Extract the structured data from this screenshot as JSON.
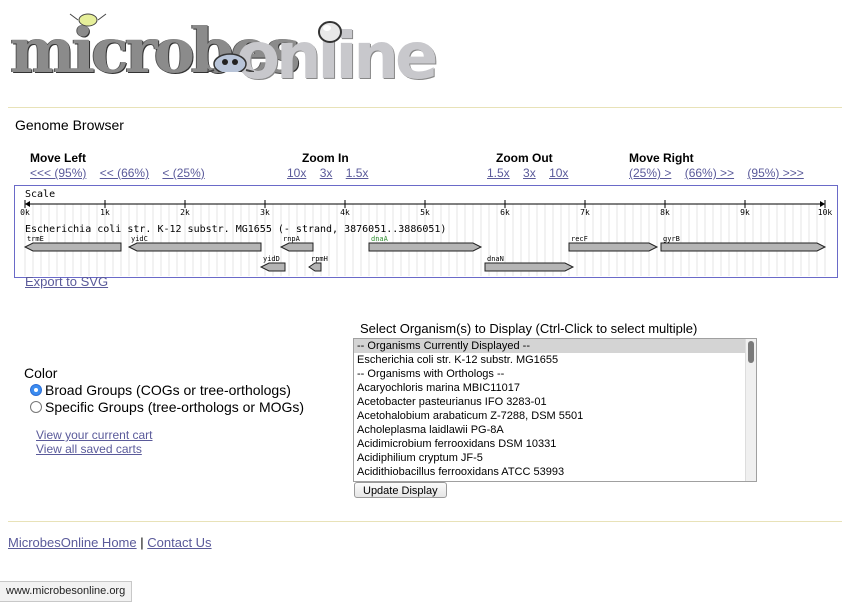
{
  "logo": {
    "left": "microbes",
    "right": "online"
  },
  "browser_title": "Genome Browser",
  "nav": {
    "move_left": {
      "heading": "Move Left",
      "links": [
        "<<< (95%)",
        "<< (66%)",
        "< (25%)"
      ]
    },
    "zoom_in": {
      "heading": "Zoom In",
      "links": [
        "10x",
        "3x",
        "1.5x"
      ]
    },
    "zoom_out": {
      "heading": "Zoom Out",
      "links": [
        "1.5x",
        "3x",
        "10x"
      ]
    },
    "move_right": {
      "heading": "Move Right",
      "links": [
        "(25%) >",
        "(66%) >>",
        "(95%) >>>"
      ]
    }
  },
  "map": {
    "scale_label": "Scale",
    "ticks": [
      "0k",
      "1k",
      "2k",
      "3k",
      "4k",
      "5k",
      "6k",
      "7k",
      "8k",
      "9k",
      "10k"
    ],
    "genome_label": "Escherichia coli str. K-12 substr. MG1655 (- strand, 3876051..3886051)",
    "genes": [
      {
        "name": "trmE",
        "start": 0.0,
        "end": 1.2,
        "strand": "-",
        "row": 0,
        "color": "#000000"
      },
      {
        "name": "yidC",
        "start": 1.3,
        "end": 2.95,
        "strand": "-",
        "row": 0,
        "color": "#000000"
      },
      {
        "name": "rnpA",
        "start": 3.2,
        "end": 3.6,
        "strand": "-",
        "row": 0,
        "color": "#000000"
      },
      {
        "name": "dnaA",
        "start": 4.3,
        "end": 5.7,
        "strand": "+",
        "row": 0,
        "color": "#2f8f2f"
      },
      {
        "name": "recF",
        "start": 6.8,
        "end": 7.9,
        "strand": "+",
        "row": 0,
        "color": "#000000"
      },
      {
        "name": "gyrB",
        "start": 7.95,
        "end": 10.0,
        "strand": "+",
        "row": 0,
        "color": "#000000"
      },
      {
        "name": "yidD",
        "start": 2.95,
        "end": 3.25,
        "strand": "-",
        "row": 1,
        "color": "#000000"
      },
      {
        "name": "rpmH",
        "start": 3.55,
        "end": 3.7,
        "strand": "-",
        "row": 1,
        "color": "#000000"
      },
      {
        "name": "dnaN",
        "start": 5.75,
        "end": 6.85,
        "strand": "+",
        "row": 1,
        "color": "#000000"
      }
    ]
  },
  "export_svg": "Export to SVG",
  "color": {
    "title": "Color",
    "options": [
      {
        "label": "Broad Groups (COGs or tree-orthologs)",
        "checked": true
      },
      {
        "label": "Specific Groups (tree-orthologs or MOGs)",
        "checked": false
      }
    ]
  },
  "cart": {
    "view": "View your current cart",
    "saved": "View all saved carts"
  },
  "organisms": {
    "title": "Select Organism(s) to Display (Ctrl-Click to select multiple)",
    "items": [
      {
        "label": "-- Organisms Currently Displayed --",
        "selected": true
      },
      {
        "label": "Escherichia coli str. K-12 substr. MG1655",
        "selected": false
      },
      {
        "label": "-- Organisms with Orthologs --",
        "selected": false
      },
      {
        "label": "Acaryochloris marina MBIC11017",
        "selected": false
      },
      {
        "label": "Acetobacter pasteurianus IFO 3283-01",
        "selected": false
      },
      {
        "label": "Acetohalobium arabaticum Z-7288, DSM 5501",
        "selected": false
      },
      {
        "label": "Acholeplasma laidlawii PG-8A",
        "selected": false
      },
      {
        "label": "Acidimicrobium ferrooxidans DSM 10331",
        "selected": false
      },
      {
        "label": "Acidiphilium cryptum JF-5",
        "selected": false
      },
      {
        "label": "Acidithiobacillus ferrooxidans ATCC 53993",
        "selected": false
      }
    ],
    "update_button": "Update Display"
  },
  "footer": {
    "home": "MicrobesOnline Home",
    "separator": "|",
    "contact": "Contact Us"
  },
  "status_bar": "www.microbesonline.org"
}
